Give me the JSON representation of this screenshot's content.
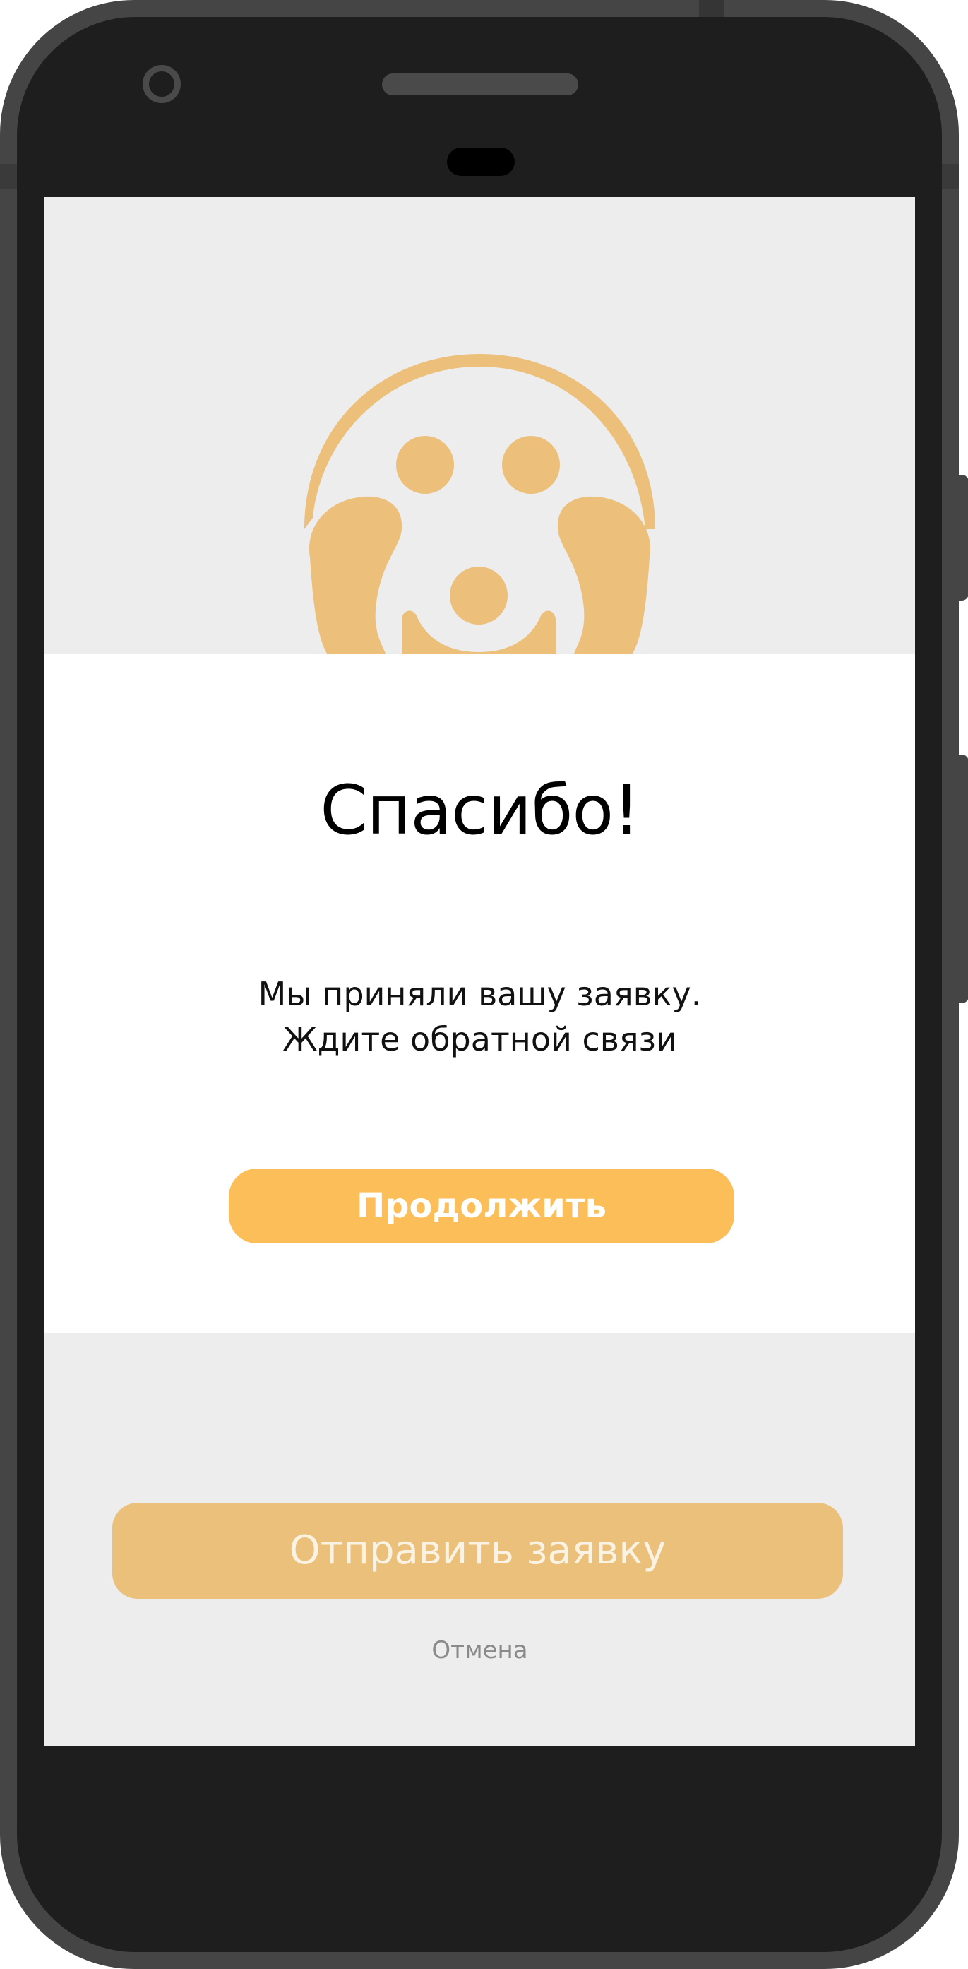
{
  "colors": {
    "accent": "#fcbe58",
    "mascot": "#ecc07a",
    "screen_background": "#ededed",
    "card_background": "#ffffff",
    "phone_body": "#1e1e1e",
    "cancel_text": "#8a8a8a"
  },
  "mascot": {
    "icon": "dog-face-icon"
  },
  "dialog": {
    "title": "Спасибо!",
    "message_line1": "Мы приняли вашу заявку.",
    "message_line2": "Ждите обратной связи",
    "continue_label": "Продолжить"
  },
  "form": {
    "submit_label": "Отправить заявку",
    "cancel_label": "Отмена"
  }
}
